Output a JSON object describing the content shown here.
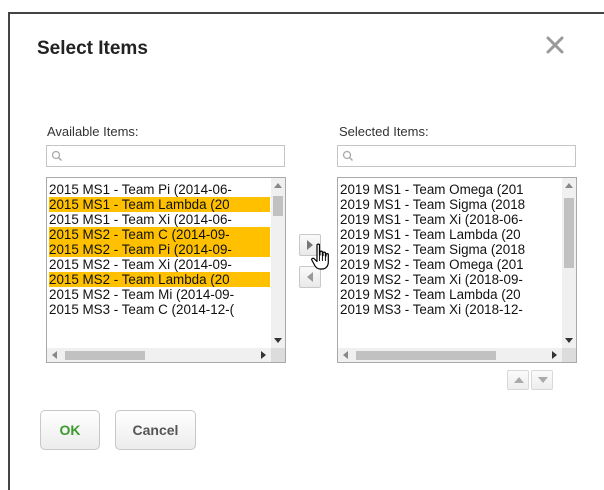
{
  "dialog": {
    "title": "Select Items",
    "close_icon": "close-icon"
  },
  "available": {
    "label": "Available Items:",
    "search_placeholder": "",
    "items": [
      {
        "label": "2015 MS1 - Team Pi (2014-06-",
        "selected": false
      },
      {
        "label": "2015 MS1 - Team Lambda (20",
        "selected": true
      },
      {
        "label": "2015 MS1 - Team Xi (2014-06-",
        "selected": false
      },
      {
        "label": "2015 MS2 - Team C (2014-09-",
        "selected": true
      },
      {
        "label": "2015 MS2 - Team Pi (2014-09-",
        "selected": true
      },
      {
        "label": "2015 MS2 - Team Xi (2014-09-",
        "selected": false
      },
      {
        "label": "2015 MS2 - Team Lambda (20",
        "selected": true
      },
      {
        "label": "2015 MS2 - Team Mi (2014-09-",
        "selected": false
      },
      {
        "label": "2015 MS3 - Team C (2014-12-(",
        "selected": false
      }
    ]
  },
  "selected": {
    "label": "Selected Items:",
    "search_placeholder": "",
    "items": [
      {
        "label": "2019 MS1 - Team Omega (201",
        "selected": false
      },
      {
        "label": "2019 MS1 - Team Sigma (2018",
        "selected": false
      },
      {
        "label": "2019 MS1 - Team Xi (2018-06-",
        "selected": false
      },
      {
        "label": "2019 MS1 - Team Lambda (20",
        "selected": false
      },
      {
        "label": "2019 MS2 - Team Sigma (2018",
        "selected": false
      },
      {
        "label": "2019 MS2 - Team Omega (201",
        "selected": false
      },
      {
        "label": "2019 MS2 - Team Xi (2018-09-",
        "selected": false
      },
      {
        "label": "2019 MS2 - Team Lambda (20",
        "selected": false
      },
      {
        "label": "2019 MS3 - Team Xi (2018-12-",
        "selected": false
      }
    ]
  },
  "transfer": {
    "add_icon": "chevron-right-icon",
    "remove_icon": "chevron-left-icon"
  },
  "order": {
    "up_icon": "triangle-up-icon",
    "down_icon": "triangle-down-icon"
  },
  "buttons": {
    "ok_label": "OK",
    "cancel_label": "Cancel"
  },
  "colors": {
    "selection": "#ffc000",
    "ok_text": "#3c9a2d"
  }
}
